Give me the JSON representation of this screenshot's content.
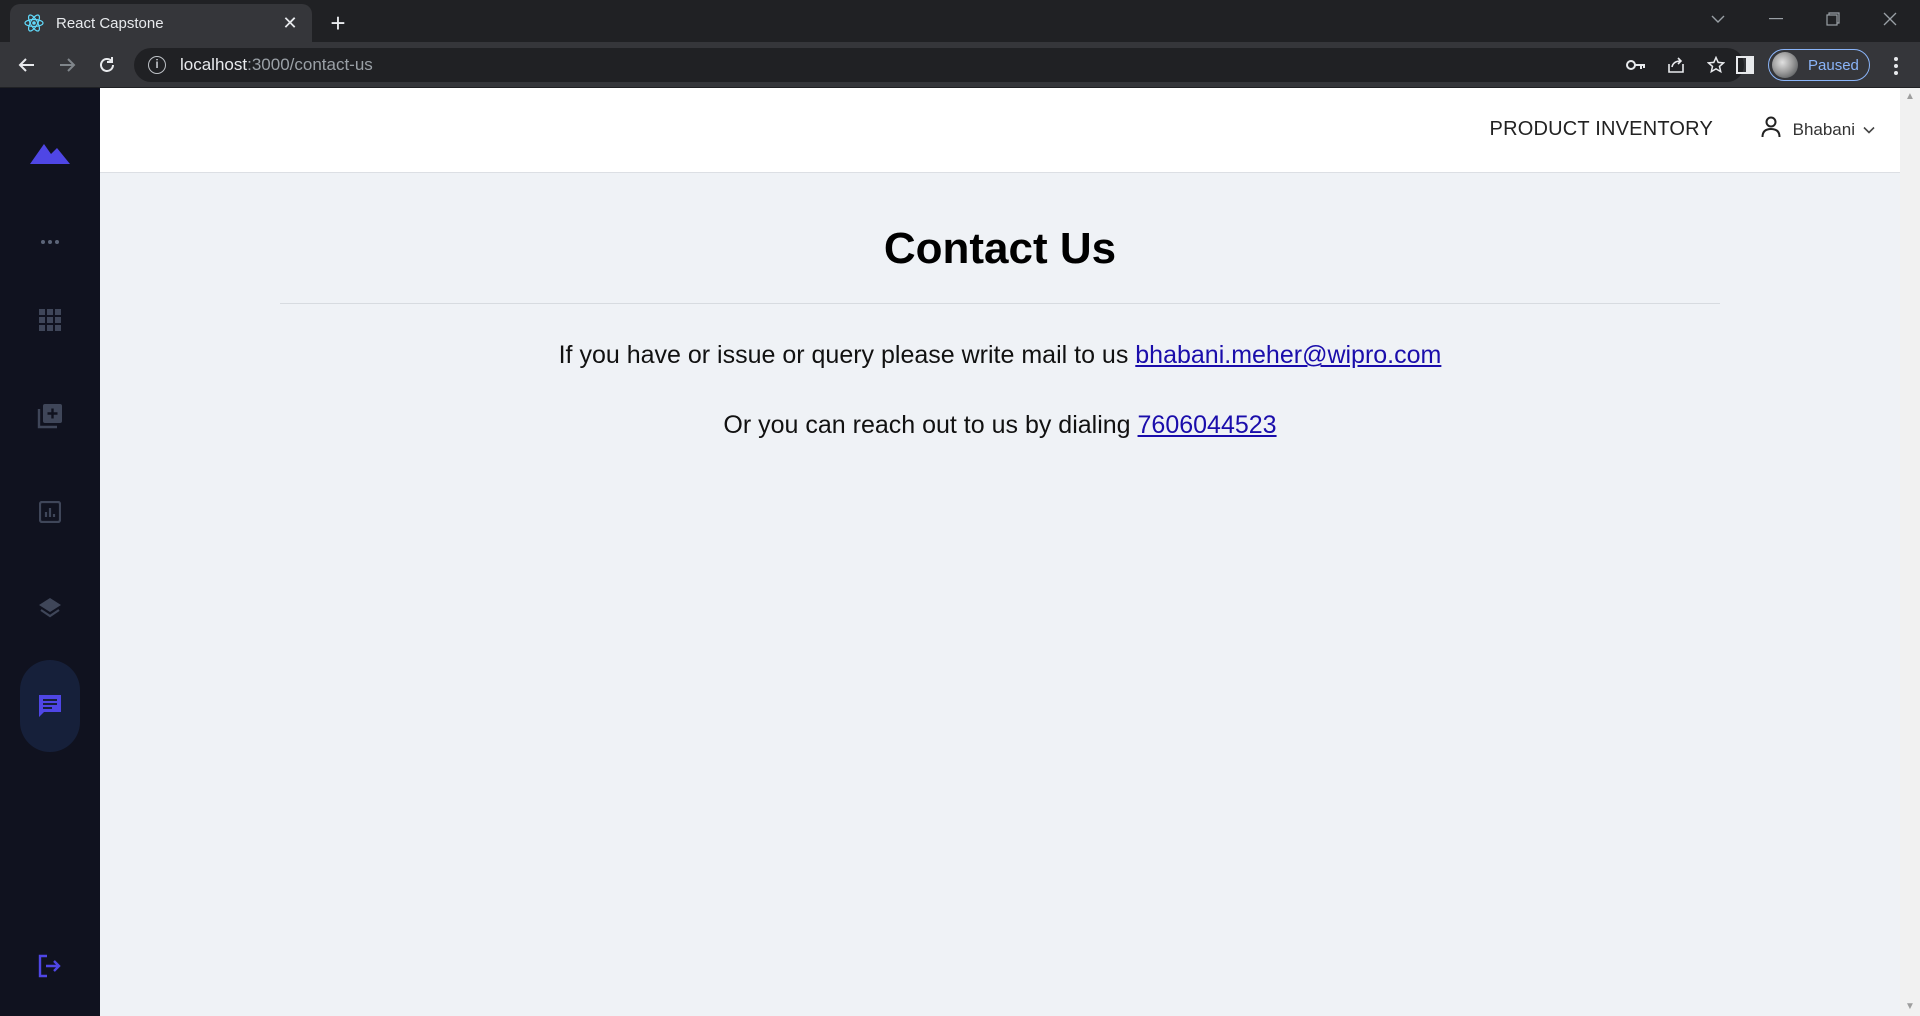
{
  "browser": {
    "tab_title": "React Capstone",
    "tab_close": "✕",
    "new_tab": "+",
    "url_host": "localhost",
    "url_path": ":3000/contact-us",
    "profile_label": "Paused"
  },
  "header": {
    "brand": "PRODUCT INVENTORY",
    "user_name": "Bhabani"
  },
  "main": {
    "title": "Contact Us",
    "email_text": "If you have or issue or query please write mail to us ",
    "email_link": "bhabani.meher@wipro.com",
    "phone_text": "Or you can reach out to us by dialing ",
    "phone_link": "7606044523"
  },
  "sidebar": {
    "items": [
      "logo-icon",
      "more-icon",
      "apps-grid-icon",
      "add-library-icon",
      "analytics-icon",
      "layers-icon",
      "chat-icon",
      "logout-icon"
    ],
    "active": "chat-icon"
  },
  "colors": {
    "accent": "#4f46e5",
    "sidebar_bg": "#10121f",
    "page_bg": "#eff2f6",
    "link": "#1a0dab"
  }
}
